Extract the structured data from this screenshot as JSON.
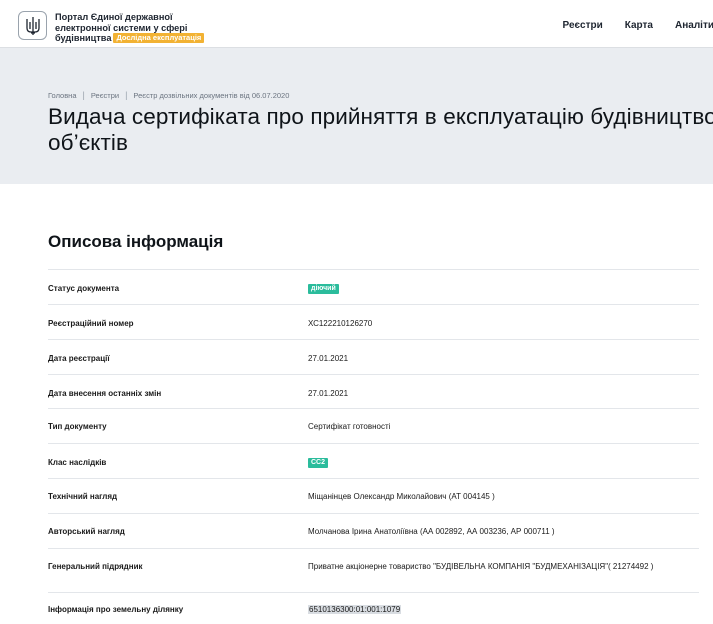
{
  "header": {
    "brand_line1": "Портал Єдиної державної",
    "brand_line2": "електронної системи у сфері",
    "brand_line3": "будівництва",
    "test_badge": "Дослідна експлуатація",
    "nav": [
      "Реєстри",
      "Карта",
      "Аналіти"
    ]
  },
  "breadcrumb": [
    "Головна",
    "Реєстри",
    "Реєстр дозвільних документів від 06.07.2020"
  ],
  "page_title": "Видача сертифіката про прийняття в експлуатацію будівництвом об’єктів",
  "section_title": "Описова інформація",
  "rows": [
    {
      "label": "Статус документа",
      "value": "діючий"
    },
    {
      "label": "Реєстраційний номер",
      "value": "ХС122210126270"
    },
    {
      "label": "Дата реєстрації",
      "value": "27.01.2021"
    },
    {
      "label": "Дата внесення останніх змін",
      "value": "27.01.2021"
    },
    {
      "label": "Тип документу",
      "value": "Сертифікат готовності"
    },
    {
      "label": "Клас наслідків",
      "value": "СС2"
    },
    {
      "label": "Технічний нагляд",
      "value": "Міщанінцев Олександр Миколайович (АТ 004145 )"
    },
    {
      "label": "Авторський нагляд",
      "value": "Молчанова Ірина Анатоліївна (АА 002892, АА 003236, АР 000711 )"
    },
    {
      "label": "Генеральний підрядник",
      "value": "Приватне акціонерне товариство \"БУДІВЕЛЬНА КОМПАНІЯ \"БУДМЕХАНІЗАЦІЯ\"( 21274492 )"
    },
    {
      "label": "Інформація про земельну ділянку",
      "value": "6510136300:01:001:1079"
    }
  ],
  "colors": {
    "hero_bg": "#eaedf1",
    "status_chip": "#2bbc9c",
    "test_badge": "#f2b233"
  }
}
